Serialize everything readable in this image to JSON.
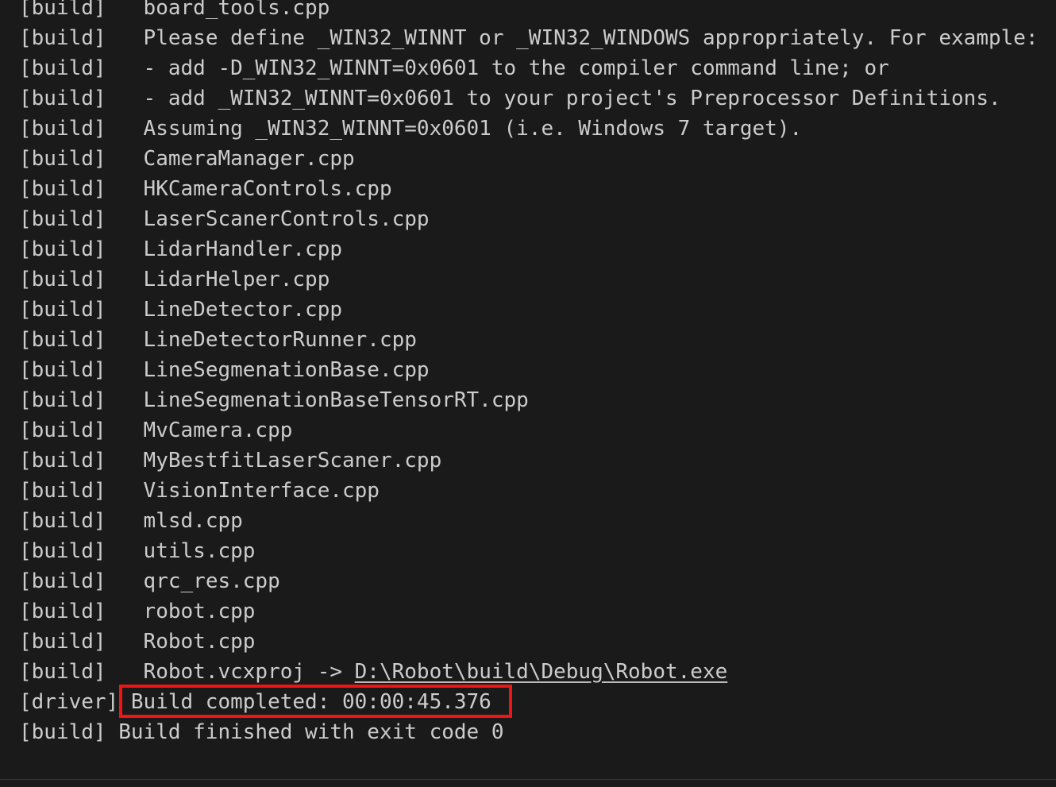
{
  "terminal": {
    "background_color": "#1a1a1a",
    "text_color": "#cccccc",
    "highlight_color": "#ee1515",
    "link_color": "#cccccc",
    "lines": [
      {
        "prefix": "[build]",
        "gap": "   ",
        "text": "board_tools.cpp"
      },
      {
        "prefix": "[build]",
        "gap": "   ",
        "text": "Please define _WIN32_WINNT or _WIN32_WINDOWS appropriately. For example:"
      },
      {
        "prefix": "[build]",
        "gap": "   ",
        "text": "- add -D_WIN32_WINNT=0x0601 to the compiler command line; or"
      },
      {
        "prefix": "[build]",
        "gap": "   ",
        "text": "- add _WIN32_WINNT=0x0601 to your project's Preprocessor Definitions."
      },
      {
        "prefix": "[build]",
        "gap": "   ",
        "text": "Assuming _WIN32_WINNT=0x0601 (i.e. Windows 7 target)."
      },
      {
        "prefix": "[build]",
        "gap": "   ",
        "text": "CameraManager.cpp"
      },
      {
        "prefix": "[build]",
        "gap": "   ",
        "text": "HKCameraControls.cpp"
      },
      {
        "prefix": "[build]",
        "gap": "   ",
        "text": "LaserScanerControls.cpp"
      },
      {
        "prefix": "[build]",
        "gap": "   ",
        "text": "LidarHandler.cpp"
      },
      {
        "prefix": "[build]",
        "gap": "   ",
        "text": "LidarHelper.cpp"
      },
      {
        "prefix": "[build]",
        "gap": "   ",
        "text": "LineDetector.cpp"
      },
      {
        "prefix": "[build]",
        "gap": "   ",
        "text": "LineDetectorRunner.cpp"
      },
      {
        "prefix": "[build]",
        "gap": "   ",
        "text": "LineSegmenationBase.cpp"
      },
      {
        "prefix": "[build]",
        "gap": "   ",
        "text": "LineSegmenationBaseTensorRT.cpp"
      },
      {
        "prefix": "[build]",
        "gap": "   ",
        "text": "MvCamera.cpp"
      },
      {
        "prefix": "[build]",
        "gap": "   ",
        "text": "MyBestfitLaserScaner.cpp"
      },
      {
        "prefix": "[build]",
        "gap": "   ",
        "text": "VisionInterface.cpp"
      },
      {
        "prefix": "[build]",
        "gap": "   ",
        "text": "mlsd.cpp"
      },
      {
        "prefix": "[build]",
        "gap": "   ",
        "text": "utils.cpp"
      },
      {
        "prefix": "[build]",
        "gap": "   ",
        "text": "qrc_res.cpp"
      },
      {
        "prefix": "[build]",
        "gap": "   ",
        "text": "robot.cpp"
      },
      {
        "prefix": "[build]",
        "gap": "   ",
        "text": "Robot.cpp"
      },
      {
        "prefix": "[build]",
        "gap": "   ",
        "text": "Robot.vcxproj -> ",
        "link": "D:\\Robot\\build\\Debug\\Robot.exe"
      },
      {
        "prefix": "[driver]",
        "gap": " ",
        "text": "Build completed: 00:00:45.376",
        "highlighted": true
      },
      {
        "prefix": "[build]",
        "gap": " ",
        "text": "Build finished with exit code 0"
      }
    ]
  },
  "annotation": {
    "type": "red-rectangle",
    "target_text": "Build completed: 00:00:45.376",
    "color": "#ee1515"
  },
  "link": {
    "path": "D:\\Robot\\build\\Debug\\Robot.exe"
  },
  "build_status": {
    "completed_label": "Build completed:",
    "duration": "00:00:45.376",
    "exit_code": "0",
    "finished_text": "Build finished with exit code 0"
  }
}
